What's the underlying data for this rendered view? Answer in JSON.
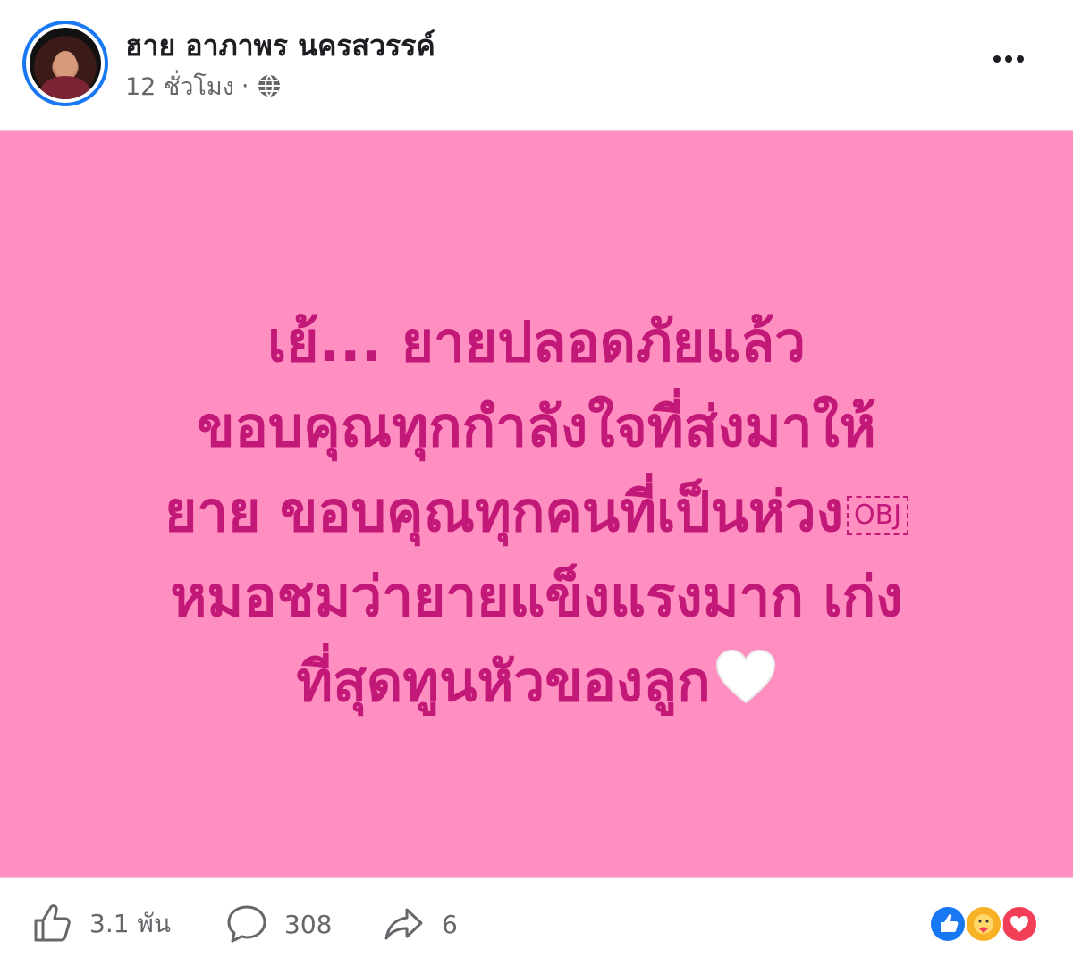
{
  "header": {
    "author_name": "ฮาย อาภาพร นครสวรรค์",
    "timestamp": "12 ชั่วโมง",
    "separator": "·",
    "privacy_icon": "globe-icon",
    "more_icon": "more-options-icon"
  },
  "post": {
    "background_color": "#ff8ec1",
    "text_color": "#c21877",
    "lines": [
      "เย้... ยายปลอดภัยแล้ว",
      "ขอบคุณทุกกำลังใจที่ส่งมาให้",
      "ยาย ขอบคุณทุกคนที่เป็นห่วง",
      "หมอชมว่ายายแข็งแรงมาก เก่ง",
      "ที่สุดทูนหัวของลูก"
    ],
    "obj_placeholder": "OBJ",
    "emoji": "white-heart-icon"
  },
  "footer": {
    "like_count": "3.1 พัน",
    "comment_count": "308",
    "share_count": "6",
    "reactions": [
      "like-reaction-icon",
      "care-reaction-icon",
      "love-reaction-icon"
    ]
  }
}
